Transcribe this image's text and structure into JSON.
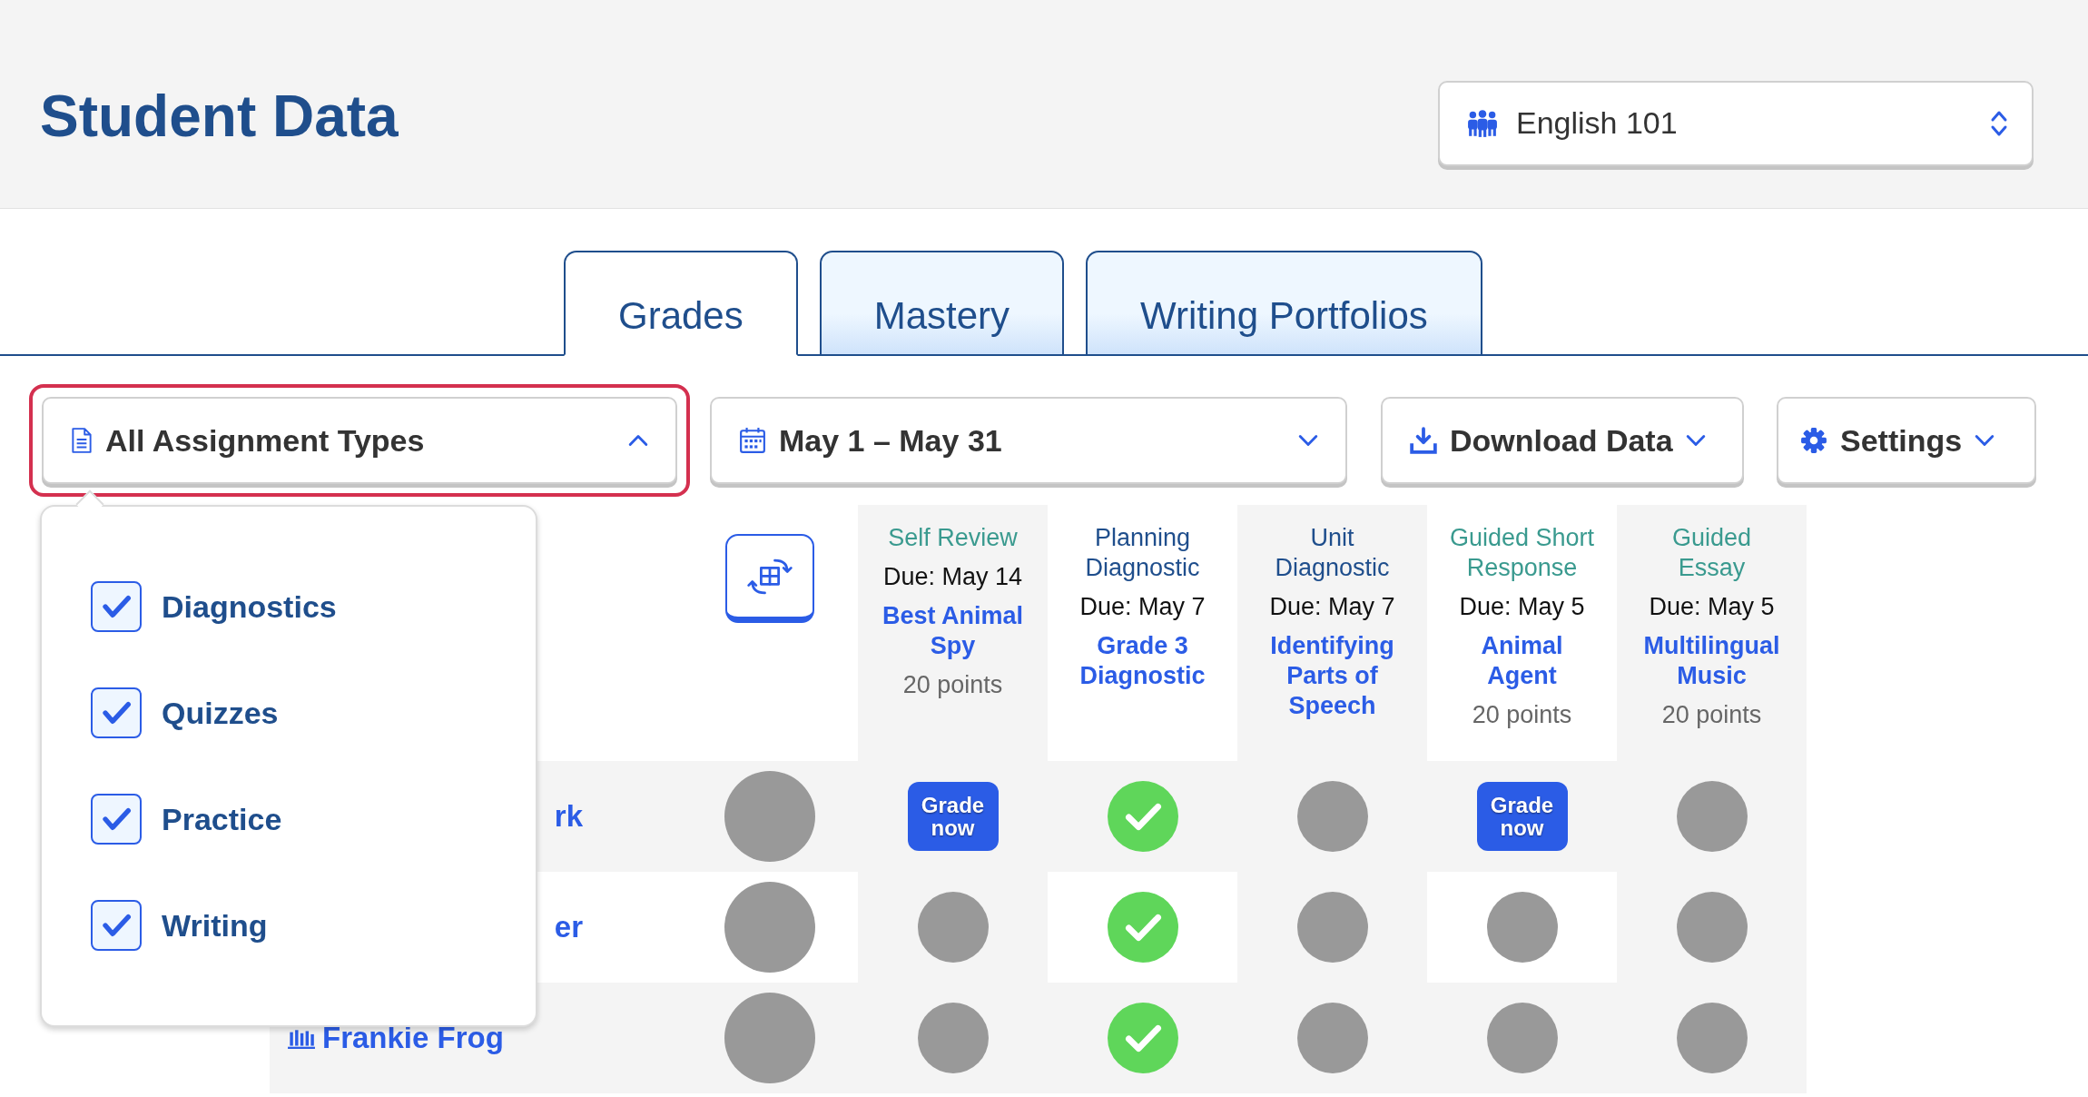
{
  "header": {
    "title": "Student Data",
    "class_select": {
      "value": "English 101"
    }
  },
  "tabs": [
    {
      "label": "Grades",
      "selected": true
    },
    {
      "label": "Mastery",
      "selected": false
    },
    {
      "label": "Writing Portfolios",
      "selected": false
    }
  ],
  "toolbar": {
    "type_filter": {
      "label": "All Assignment Types",
      "expanded": true,
      "options": [
        {
          "label": "Diagnostics",
          "checked": true
        },
        {
          "label": "Quizzes",
          "checked": true
        },
        {
          "label": "Practice",
          "checked": true
        },
        {
          "label": "Writing",
          "checked": true
        }
      ]
    },
    "date_range": {
      "label": "May 1 – May 31"
    },
    "download_button": {
      "label": "Download Data"
    },
    "settings_button": {
      "label": "Settings"
    }
  },
  "table": {
    "columns": [
      {
        "type": "Self Review",
        "color": "#3a9a8f",
        "due": "Due: May 14",
        "title": "Best Animal Spy",
        "points": "20 points"
      },
      {
        "type": "Planning Diagnostic",
        "color": "#1f4e8c",
        "due": "Due: May 7",
        "title": "Grade 3 Diagnostic"
      },
      {
        "type": "Unit Diagnostic",
        "color": "#1f4e8c",
        "due": "Due: May 7",
        "title": "Identifying Parts of Speech"
      },
      {
        "type": "Guided Short Response",
        "color": "#3a9a8f",
        "due": "Due: May 5",
        "title": "Animal Agent",
        "points": "20 points"
      },
      {
        "type": "Guided Essay",
        "color": "#3a9a8f",
        "due": "Due: May 5",
        "title": "Multilingual Music",
        "points": "20 points"
      }
    ],
    "rows": [
      {
        "student": "rk",
        "cut": true,
        "cells": [
          {
            "kind": "grade_now",
            "label": "Grade now"
          },
          {
            "kind": "complete"
          },
          {
            "kind": "empty"
          },
          {
            "kind": "grade_now",
            "label": "Grade now"
          },
          {
            "kind": "empty"
          }
        ]
      },
      {
        "student": "er",
        "cut": true,
        "cells": [
          {
            "kind": "empty"
          },
          {
            "kind": "complete"
          },
          {
            "kind": "empty"
          },
          {
            "kind": "empty"
          },
          {
            "kind": "empty"
          }
        ]
      },
      {
        "student": "Frankie Frog",
        "cut": false,
        "cells": [
          {
            "kind": "empty"
          },
          {
            "kind": "complete"
          },
          {
            "kind": "empty"
          },
          {
            "kind": "empty"
          },
          {
            "kind": "empty"
          }
        ]
      }
    ]
  }
}
